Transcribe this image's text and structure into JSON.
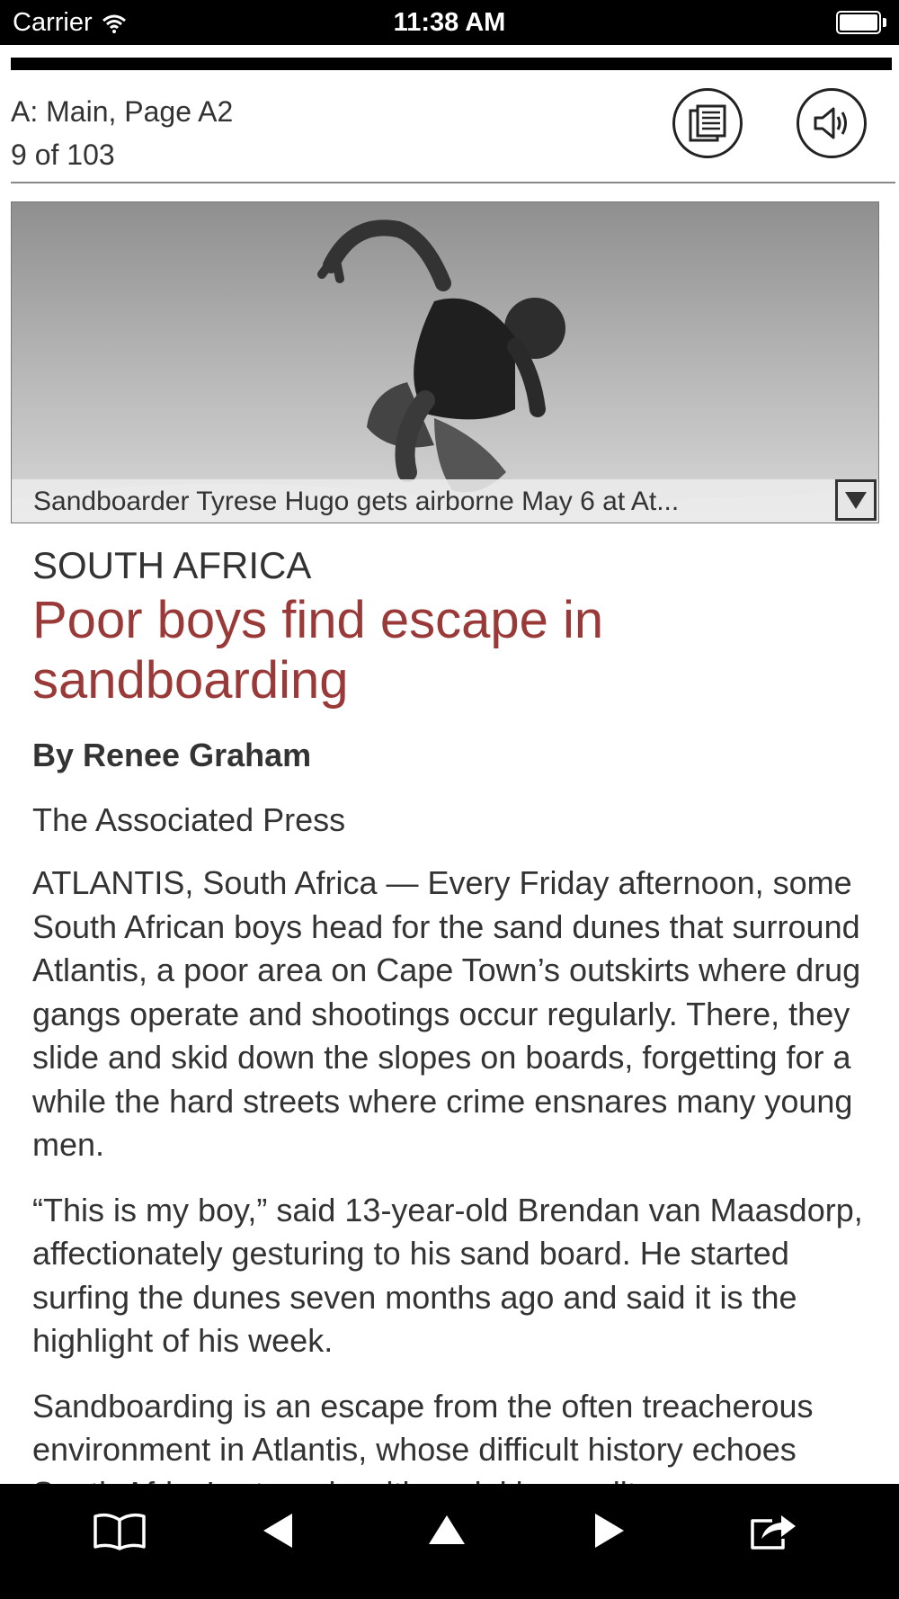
{
  "status_bar": {
    "carrier": "Carrier",
    "time": "11:38 AM",
    "icons": [
      "wifi-icon",
      "battery-icon"
    ]
  },
  "header": {
    "section_page": "A: Main, Page A2",
    "position": "9 of 103",
    "buttons": [
      "page-view-icon",
      "speaker-icon"
    ]
  },
  "photo": {
    "caption": "Sandboarder Tyrese Hugo gets airborne May 6 at At...",
    "toggle_icon": "triangle-down-icon"
  },
  "article": {
    "kicker": "SOUTH AFRICA",
    "headline": "Poor boys find escape in sandboarding",
    "byline": "By Renee Graham",
    "source": "The Associated Press",
    "paragraphs": [
      "ATLANTIS, South Africa — Every Friday afternoon, some South African boys head for the sand dunes that surround Atlantis, a poor area on Cape Town’s outskirts where drug gangs operate and shootings occur regularly. There, they slide and skid down the slopes on boards, forgetting for a while the hard streets where crime ensnares many young men.",
      "“This is my boy,” said 13-year-old Brendan van Maasdorp, affectionately gesturing to his sand board. He started surfing the dunes seven months ago and said it is the highlight of his week.",
      "Sandboarding is an escape from the often treacherous environment in Atlantis, whose difficult history echoes South Africa’s struggle with racial inequality."
    ],
    "headline_color": "#9a3a38"
  },
  "toolbar": {
    "icons": [
      "book-icon",
      "previous-icon",
      "up-icon",
      "next-icon",
      "share-icon"
    ]
  }
}
